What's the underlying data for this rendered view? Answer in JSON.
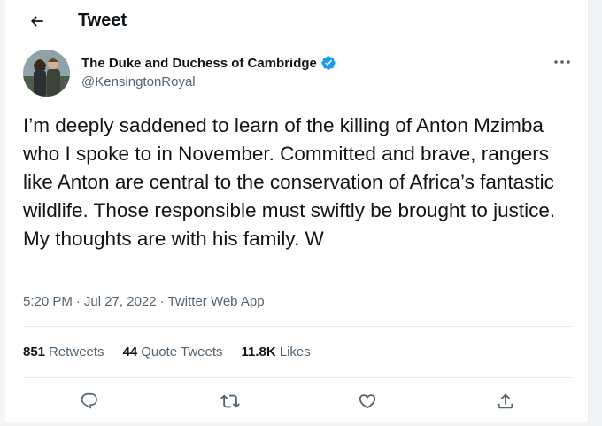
{
  "header": {
    "title": "Tweet",
    "back_icon": "arrow-left-icon"
  },
  "author": {
    "name": "The Duke and Duchess of Cambridge",
    "handle": "@KensingtonRoyal",
    "verified_icon": "verified-badge-icon",
    "verified_color": "#1d9bf0"
  },
  "tweet": {
    "text": "I’m deeply saddened to learn of the killing of Anton Mzimba who I spoke to in November. Committed and brave, rangers like Anton are central to the conservation of Africa’s fantastic wildlife. Those responsible must swiftly be brought to justice. My thoughts are with his family. W",
    "time": "5:20 PM",
    "date": "Jul 27, 2022",
    "separator": "·",
    "source": "Twitter Web App"
  },
  "stats": {
    "retweets_count": "851",
    "retweets_label": "Retweets",
    "quotes_count": "44",
    "quotes_label": "Quote Tweets",
    "likes_count": "11.8K",
    "likes_label": "Likes"
  },
  "actions": {
    "icons": [
      "reply-icon",
      "retweet-icon",
      "like-icon",
      "share-icon"
    ]
  },
  "colors": {
    "text_primary": "#0f1419",
    "text_secondary": "#536471",
    "icon_gray": "#536471",
    "divider": "#e6ecf0"
  }
}
